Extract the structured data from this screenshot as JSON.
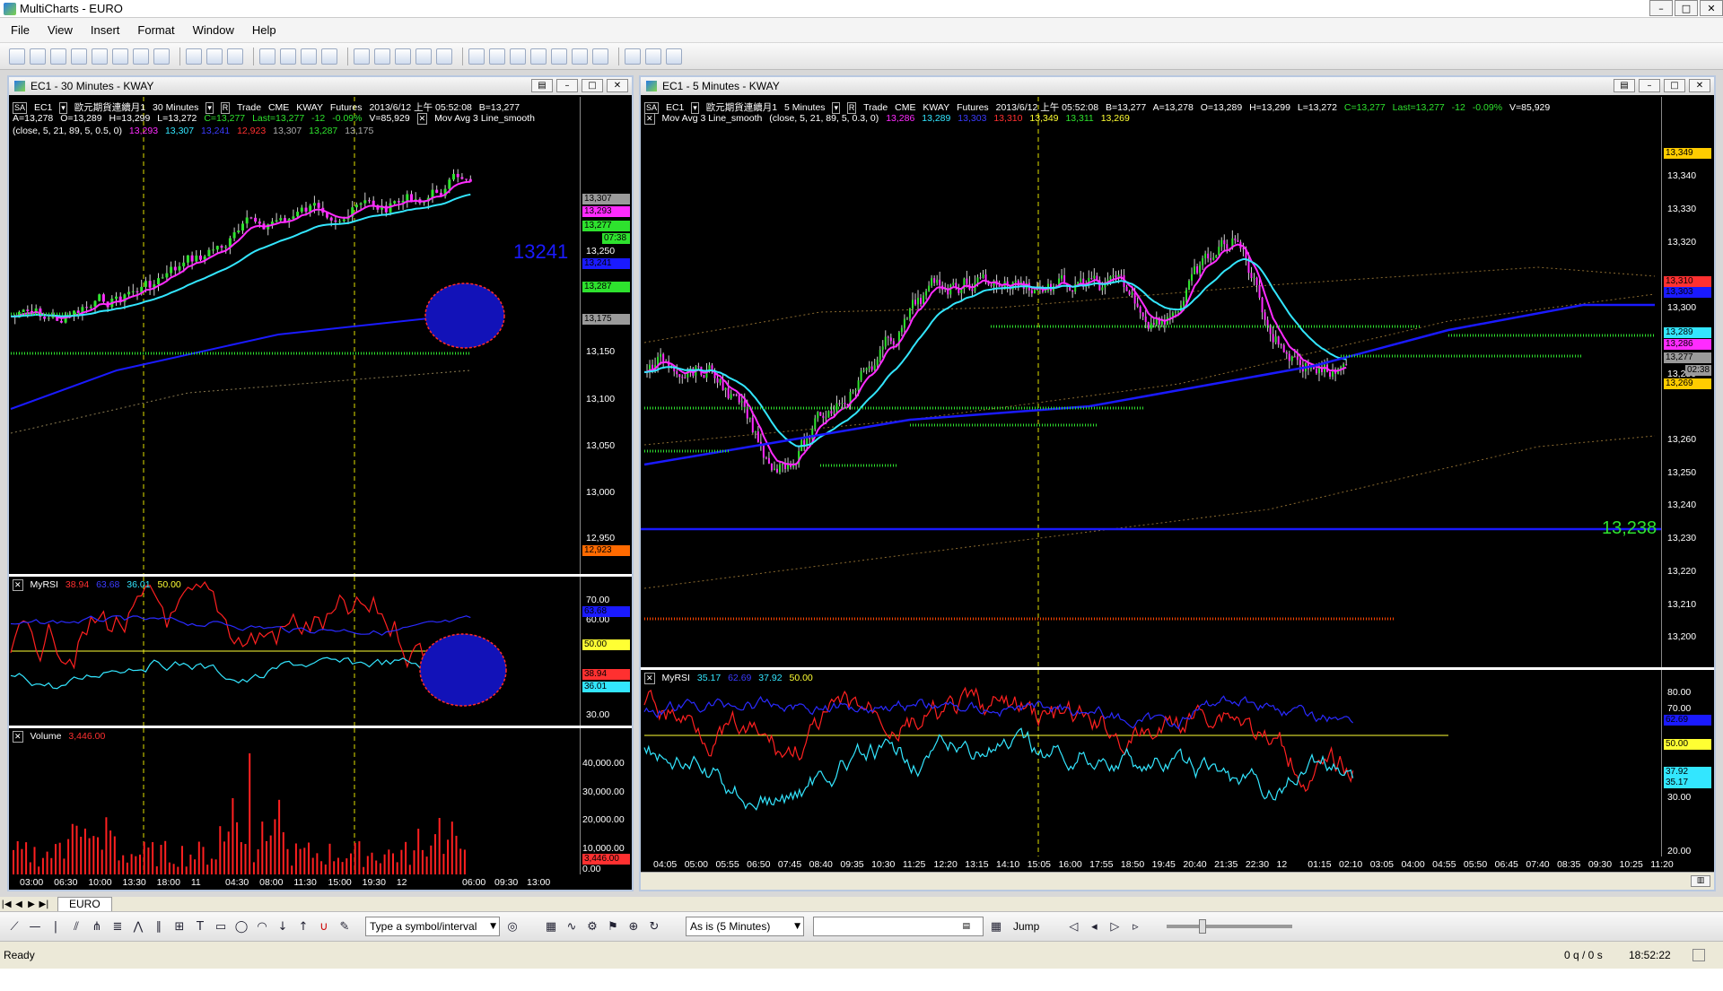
{
  "window": {
    "title": "MultiCharts - EURO"
  },
  "menu": [
    "File",
    "View",
    "Insert",
    "Format",
    "Window",
    "Help"
  ],
  "left_chart": {
    "title": "EC1 - 30 Minutes - KWAY",
    "info1": {
      "sa": "SA",
      "symbol": "EC1",
      "desc": "歐元期貨連續月1",
      "interval": "30 Minutes",
      "r": "R",
      "trade": "Trade",
      "exch": "CME",
      "feed": "KWAY",
      "type": "Futures",
      "datetime": "2013/6/12 上午 05:52:08",
      "bid": "B=13,277"
    },
    "info2": {
      "ask": "A=13,278",
      "open": "O=13,289",
      "high": "H=13,299",
      "low": "L=13,272",
      "close": "C=13,277",
      "last": "Last=13,277",
      "chg": "-12",
      "pct": "-0.09%",
      "vol": "V=85,929",
      "study": "Mov Avg 3 Line_smooth"
    },
    "info3": {
      "params": "(close, 5, 21, 89, 5, 0.5, 0)",
      "v1": "13,293",
      "v2": "13,307",
      "v3": "13,241",
      "v4": "12,923",
      "v5": "13,307",
      "v6": "13,287",
      "v7": "13,175"
    },
    "price_ticks": [
      "13,250",
      "13,150",
      "13,100",
      "13,050",
      "13,000",
      "12,950"
    ],
    "price_badges": [
      {
        "text": "13,307",
        "bg": "#9a9a9a"
      },
      {
        "text": "13,293",
        "bg": "#ff2bff"
      },
      {
        "text": "13,277",
        "bg": "#2ee22e"
      },
      {
        "text": "07:38",
        "bg": "#2ee22e"
      },
      {
        "text": "13,241",
        "bg": "#1a1aff"
      },
      {
        "text": "13,287",
        "bg": "#2ee22e"
      },
      {
        "text": "13,175",
        "bg": "#9a9a9a"
      },
      {
        "text": "12,923",
        "bg": "#ff6a00"
      }
    ],
    "annotation": "13241",
    "rsi": {
      "label": "MyRSI",
      "v1": "38.94",
      "v2": "63.68",
      "v3": "36.01",
      "v4": "50.00",
      "ticks": [
        "70.00",
        "60.00",
        "30.00"
      ],
      "badges": [
        {
          "text": "63.68",
          "bg": "#1a1aff"
        },
        {
          "text": "50.00",
          "bg": "#ffff33"
        },
        {
          "text": "38.94",
          "bg": "#ff3030"
        },
        {
          "text": "36.01",
          "bg": "#33e6ff"
        }
      ]
    },
    "volume": {
      "label": "Volume",
      "value": "3,446.00",
      "ticks": [
        "40,000.00",
        "30,000.00",
        "20,000.00",
        "10,000.00",
        "0.00"
      ],
      "badge": "3,446.00"
    },
    "time_labels": [
      "03:00",
      "06:30",
      "10:00",
      "13:30",
      "18:00",
      "11",
      "04:30",
      "08:00",
      "11:30",
      "15:00",
      "19:30",
      "12",
      "06:00",
      "09:30",
      "13:00"
    ]
  },
  "right_chart": {
    "title": "EC1 - 5 Minutes - KWAY",
    "info1": {
      "sa": "SA",
      "symbol": "EC1",
      "desc": "歐元期貨連續月1",
      "interval": "5 Minutes",
      "r": "R",
      "trade": "Trade",
      "exch": "CME",
      "feed": "KWAY",
      "type": "Futures",
      "datetime": "2013/6/12 上午 05:52:08",
      "bid": "B=13,277",
      "ask": "A=13,278",
      "open": "O=13,289",
      "high": "H=13,299",
      "low": "L=13,272",
      "close": "C=13,277",
      "last": "Last=13,277",
      "chg": "-12",
      "pct": "-0.09%",
      "vol": "V=85,929"
    },
    "info2": {
      "study": "Mov Avg 3 Line_smooth",
      "params": "(close, 5, 21, 89, 5, 0.3, 0)",
      "v1": "13,286",
      "v2": "13,289",
      "v3": "13,303",
      "v4": "13,310",
      "v5": "13,349",
      "v6": "13,311",
      "v7": "13,269"
    },
    "price_ticks": [
      "13,340",
      "13,330",
      "13,320",
      "13,300",
      "13,280",
      "13,260",
      "13,250",
      "13,240",
      "13,230",
      "13,220",
      "13,210",
      "13,200"
    ],
    "price_badges": [
      {
        "text": "13,349",
        "bg": "#ffcc00"
      },
      {
        "text": "13,310",
        "bg": "#ff3030"
      },
      {
        "text": "13,303",
        "bg": "#1a1aff"
      },
      {
        "text": "13,289",
        "bg": "#33e6ff"
      },
      {
        "text": "13,286",
        "bg": "#ff2bff"
      },
      {
        "text": "13,277",
        "bg": "#9a9a9a"
      },
      {
        "text": "02:38",
        "bg": "#9a9a9a"
      },
      {
        "text": "13,269",
        "bg": "#ffcc00"
      }
    ],
    "annotation": "13,238",
    "rsi": {
      "label": "MyRSI",
      "v1": "35.17",
      "v2": "62.69",
      "v3": "37.92",
      "v4": "50.00",
      "ticks": [
        "80.00",
        "70.00",
        "30.00",
        "20.00"
      ],
      "badges": [
        {
          "text": "62.69",
          "bg": "#1a1aff"
        },
        {
          "text": "50.00",
          "bg": "#ffff33"
        },
        {
          "text": "37.92",
          "bg": "#33e6ff"
        },
        {
          "text": "35.17",
          "bg": "#33e6ff"
        }
      ]
    },
    "time_labels": [
      "04:05",
      "05:00",
      "05:55",
      "06:50",
      "07:45",
      "08:40",
      "09:35",
      "10:30",
      "11:25",
      "12:20",
      "13:15",
      "14:10",
      "15:05",
      "16:00",
      "17:55",
      "18:50",
      "19:45",
      "20:40",
      "21:35",
      "22:30",
      "12",
      "01:15",
      "02:10",
      "03:05",
      "04:00",
      "04:55",
      "05:50",
      "06:45",
      "07:40",
      "08:35",
      "09:30",
      "10:25",
      "11:20"
    ]
  },
  "workspace_tab": "EURO",
  "symbol_input": {
    "placeholder": "Type a symbol/interval"
  },
  "interval_select": "As is (5 Minutes)",
  "jump_label": "Jump",
  "status": {
    "text": "Ready",
    "queue": "0 q / 0 s",
    "time": "18:52:22"
  }
}
